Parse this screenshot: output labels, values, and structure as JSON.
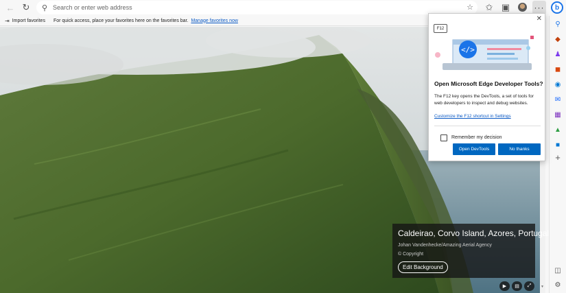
{
  "toolbar": {
    "address_placeholder": "Search or enter web address"
  },
  "favorites_bar": {
    "import_label": "Import favorites",
    "message": "For quick access, place your favorites here on the favorites bar.",
    "manage_link": "Manage favorites now"
  },
  "popup": {
    "key_label": "F12",
    "title": "Open Microsoft Edge Developer Tools?",
    "body": "The F12 key opens the DevTools, a set of tools for web developers to inspect and debug websites.",
    "link": "Customize the F12 shortcut in Settings",
    "checkbox_label": "Remember my decision",
    "primary_button": "Open DevTools",
    "secondary_button": "No thanks",
    "checkbox_checked": false
  },
  "background_info": {
    "title": "Caldeirao, Corvo Island, Azores, Portugal",
    "author": "Johan Vandenhecke/Amazing Aerial Agency",
    "copyright": "© Copyright",
    "edit_button": "Edit Background"
  },
  "colors": {
    "accent": "#0067c0",
    "link": "#0a59c4",
    "bing": "#1b74e8"
  },
  "icons": {
    "sidebar": [
      "search-icon",
      "shopping-tag-icon",
      "games-icon",
      "microsoft365-icon",
      "outlook-icon",
      "onenote-icon",
      "tree-icon",
      "add-icon",
      "sidebar-toggle-icon",
      "settings-icon"
    ]
  }
}
